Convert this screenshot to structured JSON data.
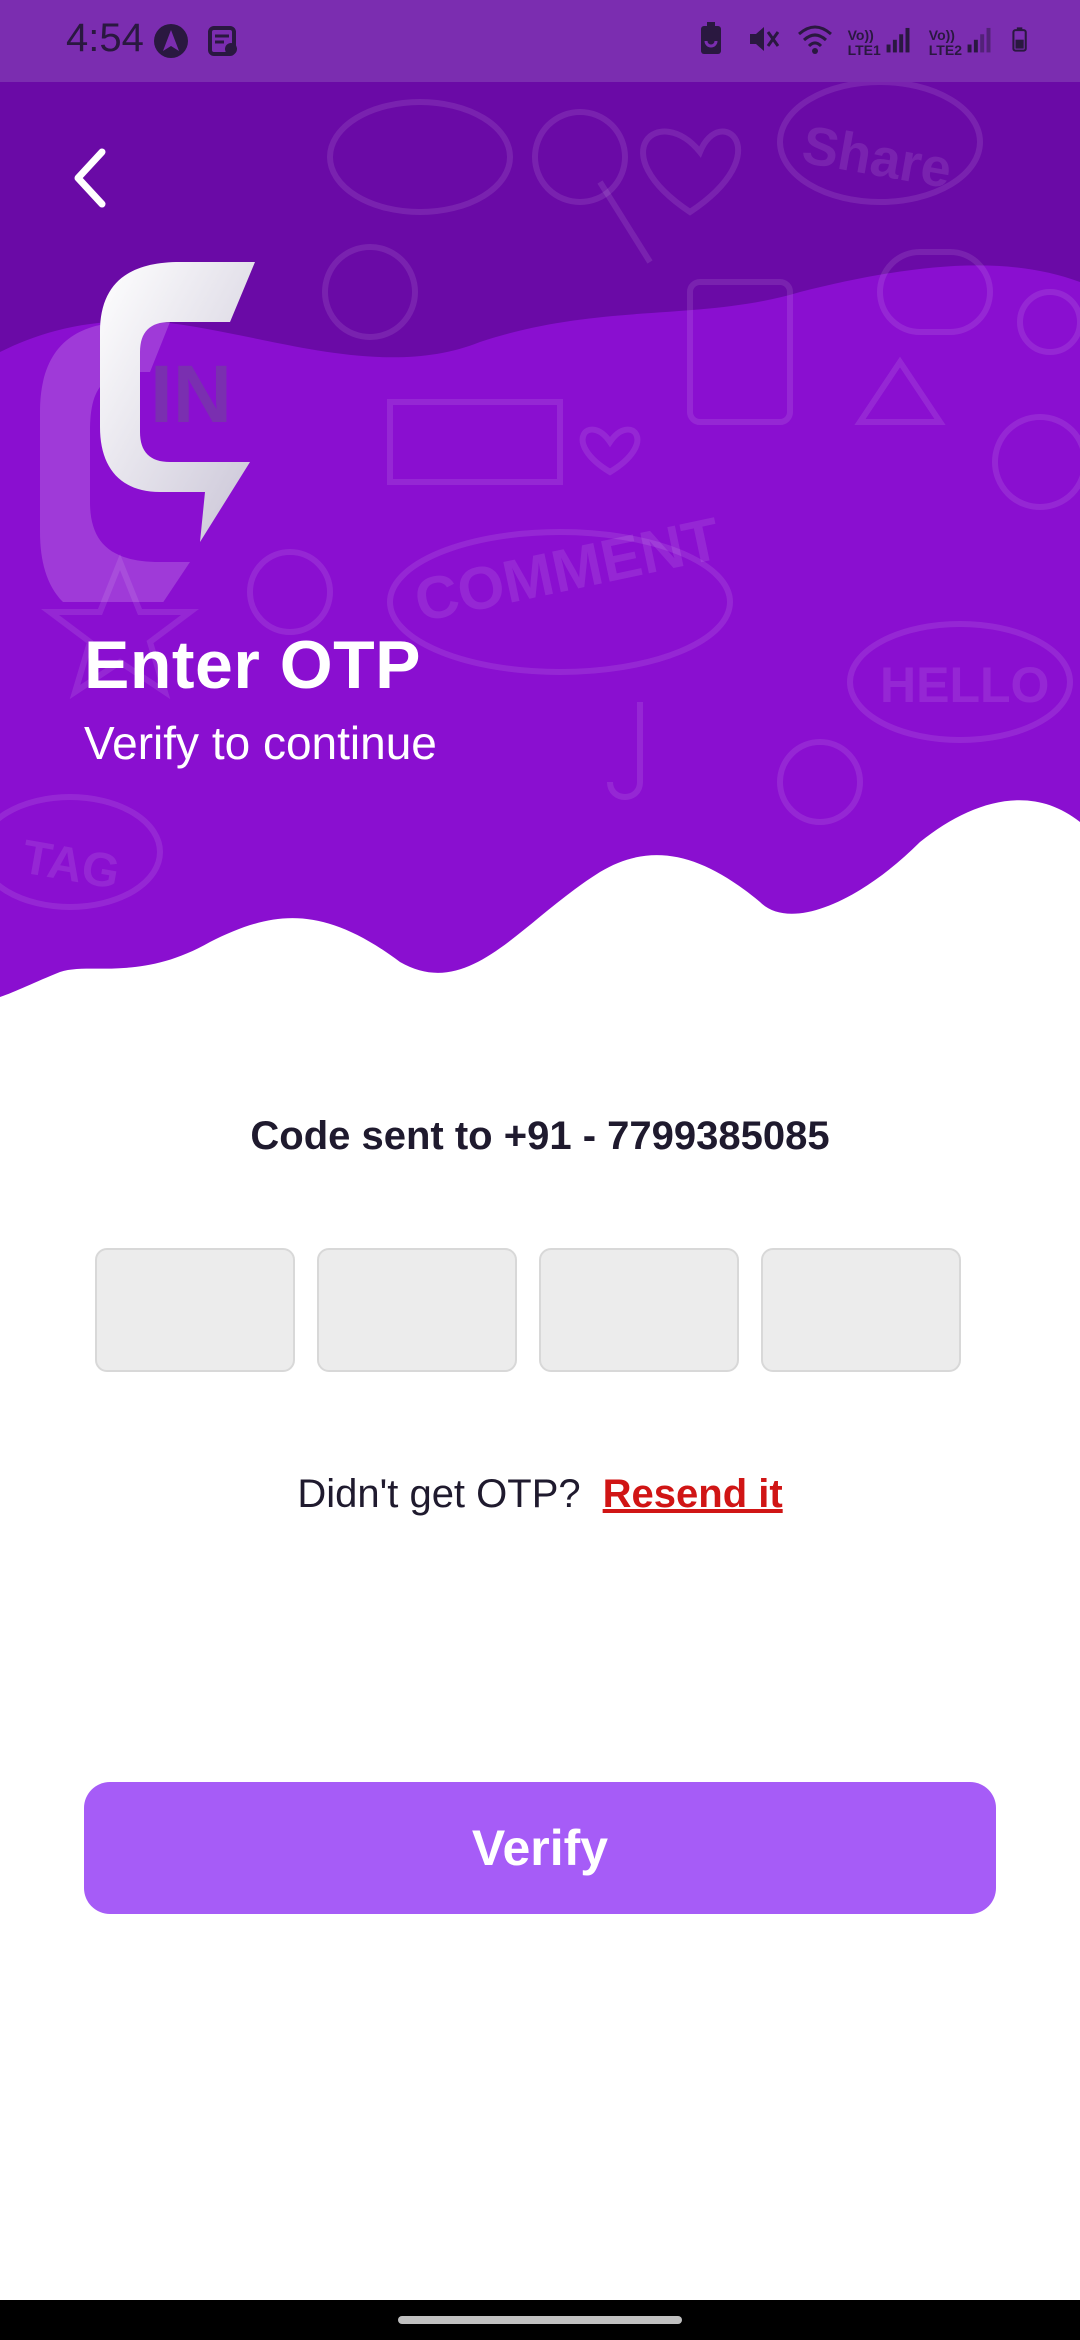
{
  "status_bar": {
    "time": "4:54",
    "left_icons": [
      "navigation-app-icon",
      "notes-notification-icon"
    ],
    "right_icons": [
      "battery-saver-icon",
      "mute-vibrate-icon",
      "wifi-icon",
      "volte-lte1-signal-icon",
      "volte-lte2-signal-icon",
      "battery-icon"
    ],
    "sim1_label": "LTE1",
    "sim2_label": "LTE2",
    "volte_label": "Vo))"
  },
  "header": {
    "title": "Enter OTP",
    "subtitle": "Verify to continue",
    "logo_text": "IN",
    "doodle_words": [
      "Share",
      "COMMENT",
      "HELLO",
      "TAG"
    ]
  },
  "otp": {
    "code_sent_text": "Code sent to +91 - 7799385085",
    "boxes": [
      "",
      "",
      "",
      ""
    ],
    "resend_prompt": "Didn't get OTP?",
    "resend_link": "Resend it"
  },
  "actions": {
    "verify_label": "Verify"
  },
  "colors": {
    "header_purple": "#8a0fd0",
    "header_dark": "#6a0aa6",
    "status_bar": "#7b2db0",
    "verify_button": "#a65cf7",
    "resend_link": "#d01515",
    "otp_box": "#ececec"
  }
}
